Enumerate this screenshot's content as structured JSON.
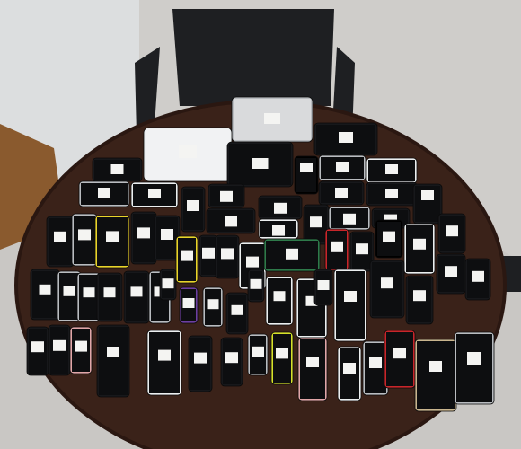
{
  "photo": {
    "colors": {
      "floor": "#c9c7c4",
      "wall": "#dcdedf",
      "cabinet": "#8a5a2e",
      "chair": "#1e1f22",
      "table": "#3a2219",
      "table_edge": "#2a1711",
      "device_dark": "#17181b",
      "device_screen": "#0d0e10",
      "device_silver": "#b9bcc0",
      "device_white": "#eceff0",
      "label": "#f4f4f2",
      "accent_yellow": "#e9d42a",
      "accent_green": "#2e7a4a",
      "accent_red": "#c8262a",
      "accent_pink": "#e1a6a8",
      "accent_purple": "#6d3fa0",
      "accent_gold": "#c9b58e",
      "accent_lime": "#d6e02a"
    },
    "rows": [
      {
        "count": 4,
        "kind": "tablets"
      },
      {
        "count": 9,
        "kind": "smartphones"
      },
      {
        "count": 14,
        "kind": "mixed phones"
      },
      {
        "count": 14,
        "kind": "mixed phones"
      },
      {
        "count": 14,
        "kind": "mixed phones"
      },
      {
        "count": 14,
        "kind": "feature phones and smartphones"
      }
    ]
  }
}
